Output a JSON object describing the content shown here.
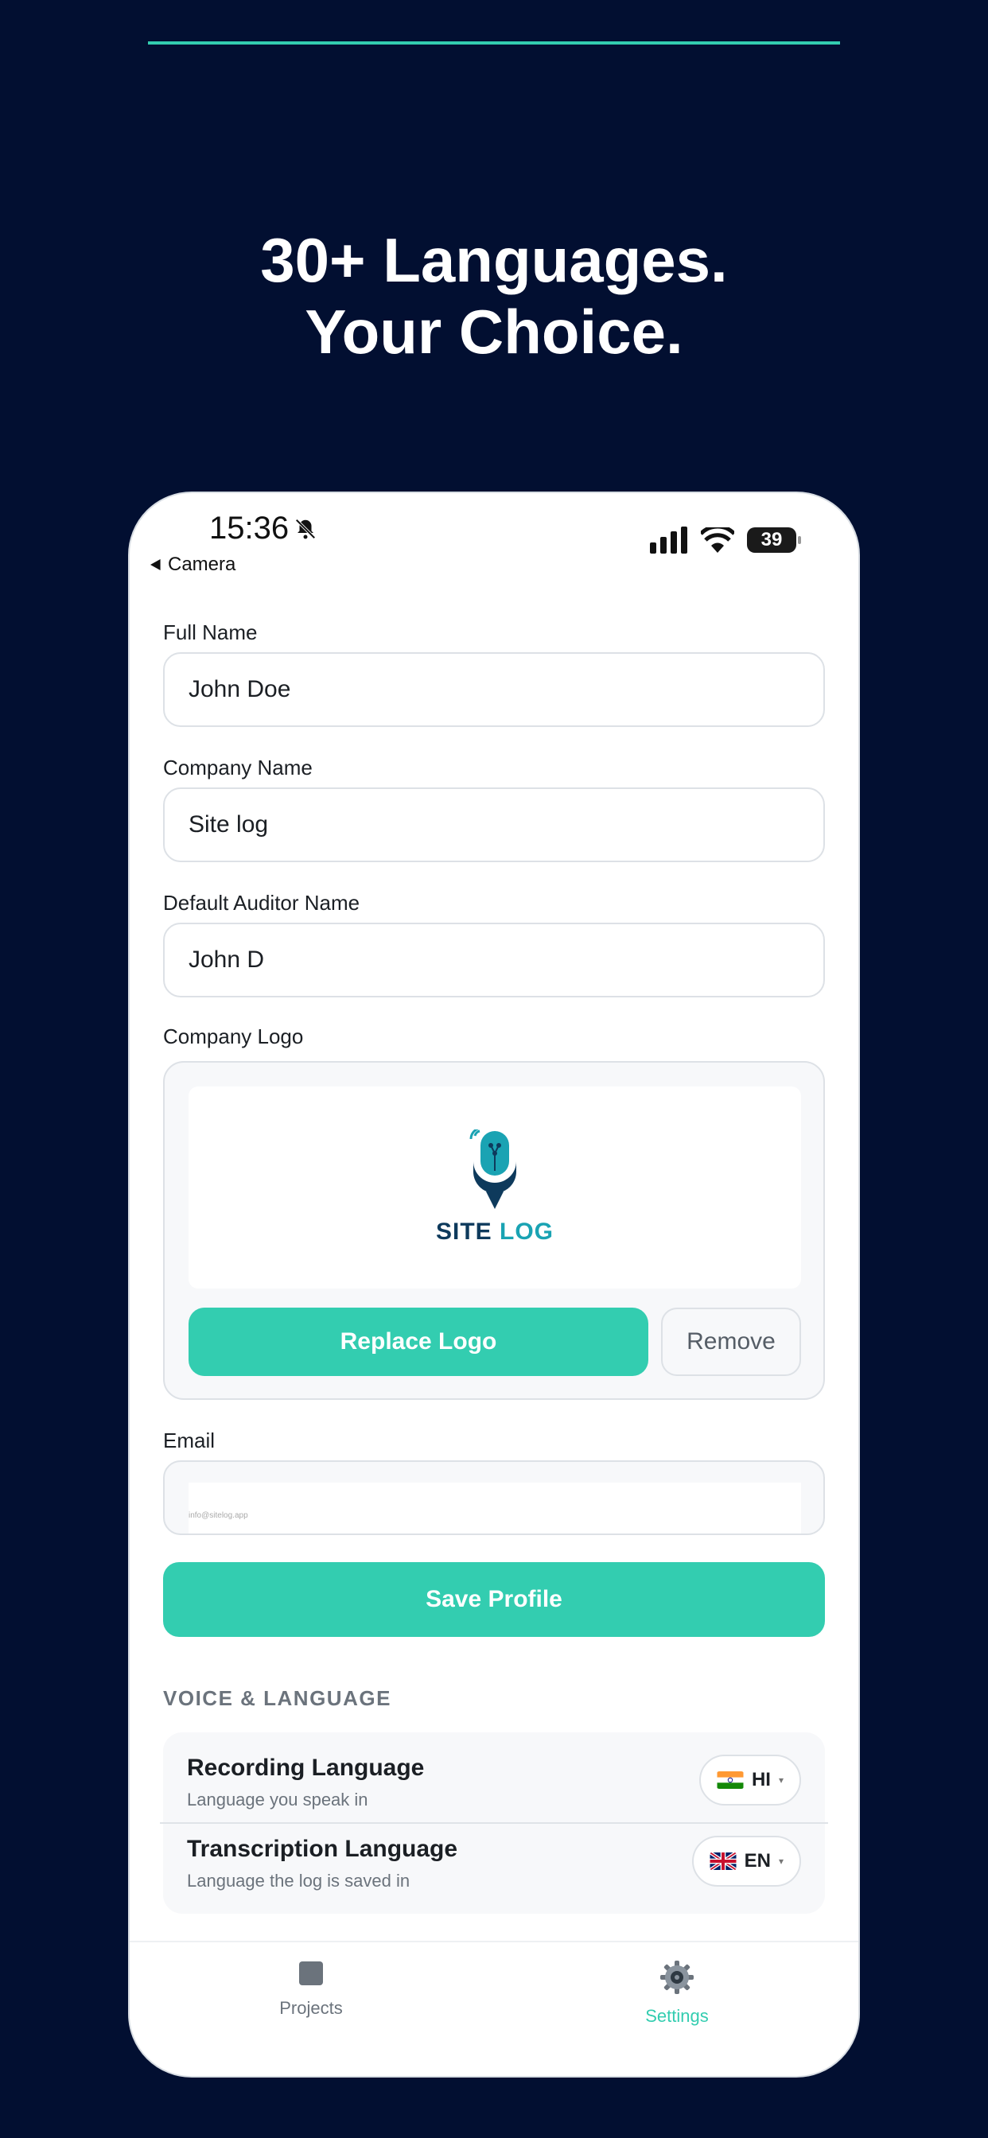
{
  "headline": {
    "line1": "30+ Languages.",
    "line2": "Your Choice."
  },
  "status_bar": {
    "time": "15:36",
    "back_label": "Camera",
    "battery": "39",
    "icons": [
      "bell-slash-icon",
      "signal-icon",
      "wifi-icon",
      "battery-icon"
    ]
  },
  "form": {
    "full_name_label": "Full Name",
    "full_name_value": "John Doe",
    "company_name_label": "Company Name",
    "company_name_value": "Site log",
    "auditor_label": "Default Auditor Name",
    "auditor_value": "John D",
    "logo_label": "Company Logo",
    "logo_text_site": "SITE",
    "logo_text_log": "LOG",
    "replace_logo": "Replace Logo",
    "remove": "Remove",
    "email_label": "Email",
    "email_value": "info@sitelog.app",
    "save_profile": "Save Profile"
  },
  "voice_language": {
    "section_title": "VOICE & LANGUAGE",
    "recording": {
      "title": "Recording Language",
      "subtitle": "Language you speak in",
      "code": "HI"
    },
    "transcription": {
      "title": "Transcription Language",
      "subtitle": "Language the log is saved in",
      "code": "EN"
    }
  },
  "tabs": {
    "projects": "Projects",
    "settings": "Settings"
  },
  "colors": {
    "background": "#020f31",
    "accent": "#33cdb0",
    "text": "#1b1f24"
  }
}
